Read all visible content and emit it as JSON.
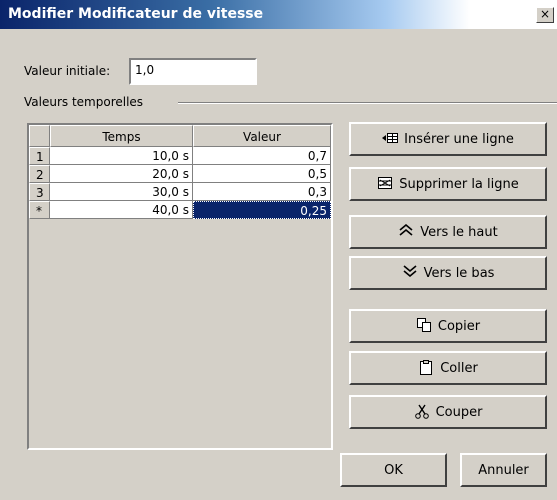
{
  "window": {
    "title": "Modifier Modificateur de vitesse",
    "close": "×"
  },
  "initial": {
    "label": "Valeur initiale:",
    "value": "1,0"
  },
  "group": {
    "label": "Valeurs temporelles"
  },
  "table": {
    "columns": [
      "Temps",
      "Valeur"
    ],
    "rows": [
      {
        "index": "1",
        "time": "10,0 s",
        "value": "0,7"
      },
      {
        "index": "2",
        "time": "20,0 s",
        "value": "0,5"
      },
      {
        "index": "3",
        "time": "30,0 s",
        "value": "0,3"
      },
      {
        "index": "*",
        "time": "40,0 s",
        "value": "0,25"
      }
    ]
  },
  "buttons": {
    "insert": "Insérer une ligne",
    "delete": "Supprimer la ligne",
    "up": "Vers le haut",
    "down": "Vers le bas",
    "copy": "Copier",
    "paste": "Coller",
    "cut": "Couper",
    "ok": "OK",
    "cancel": "Annuler"
  },
  "icons": {
    "insert": "insert-row-icon",
    "delete": "delete-row-icon",
    "up": "move-up-icon",
    "down": "move-down-icon",
    "copy": "copy-icon",
    "paste": "paste-icon",
    "cut": "scissors-icon"
  },
  "colors": {
    "title_bar": "#0a246a",
    "selection": "#0a246a",
    "window_bg": "#d4d0c8"
  }
}
